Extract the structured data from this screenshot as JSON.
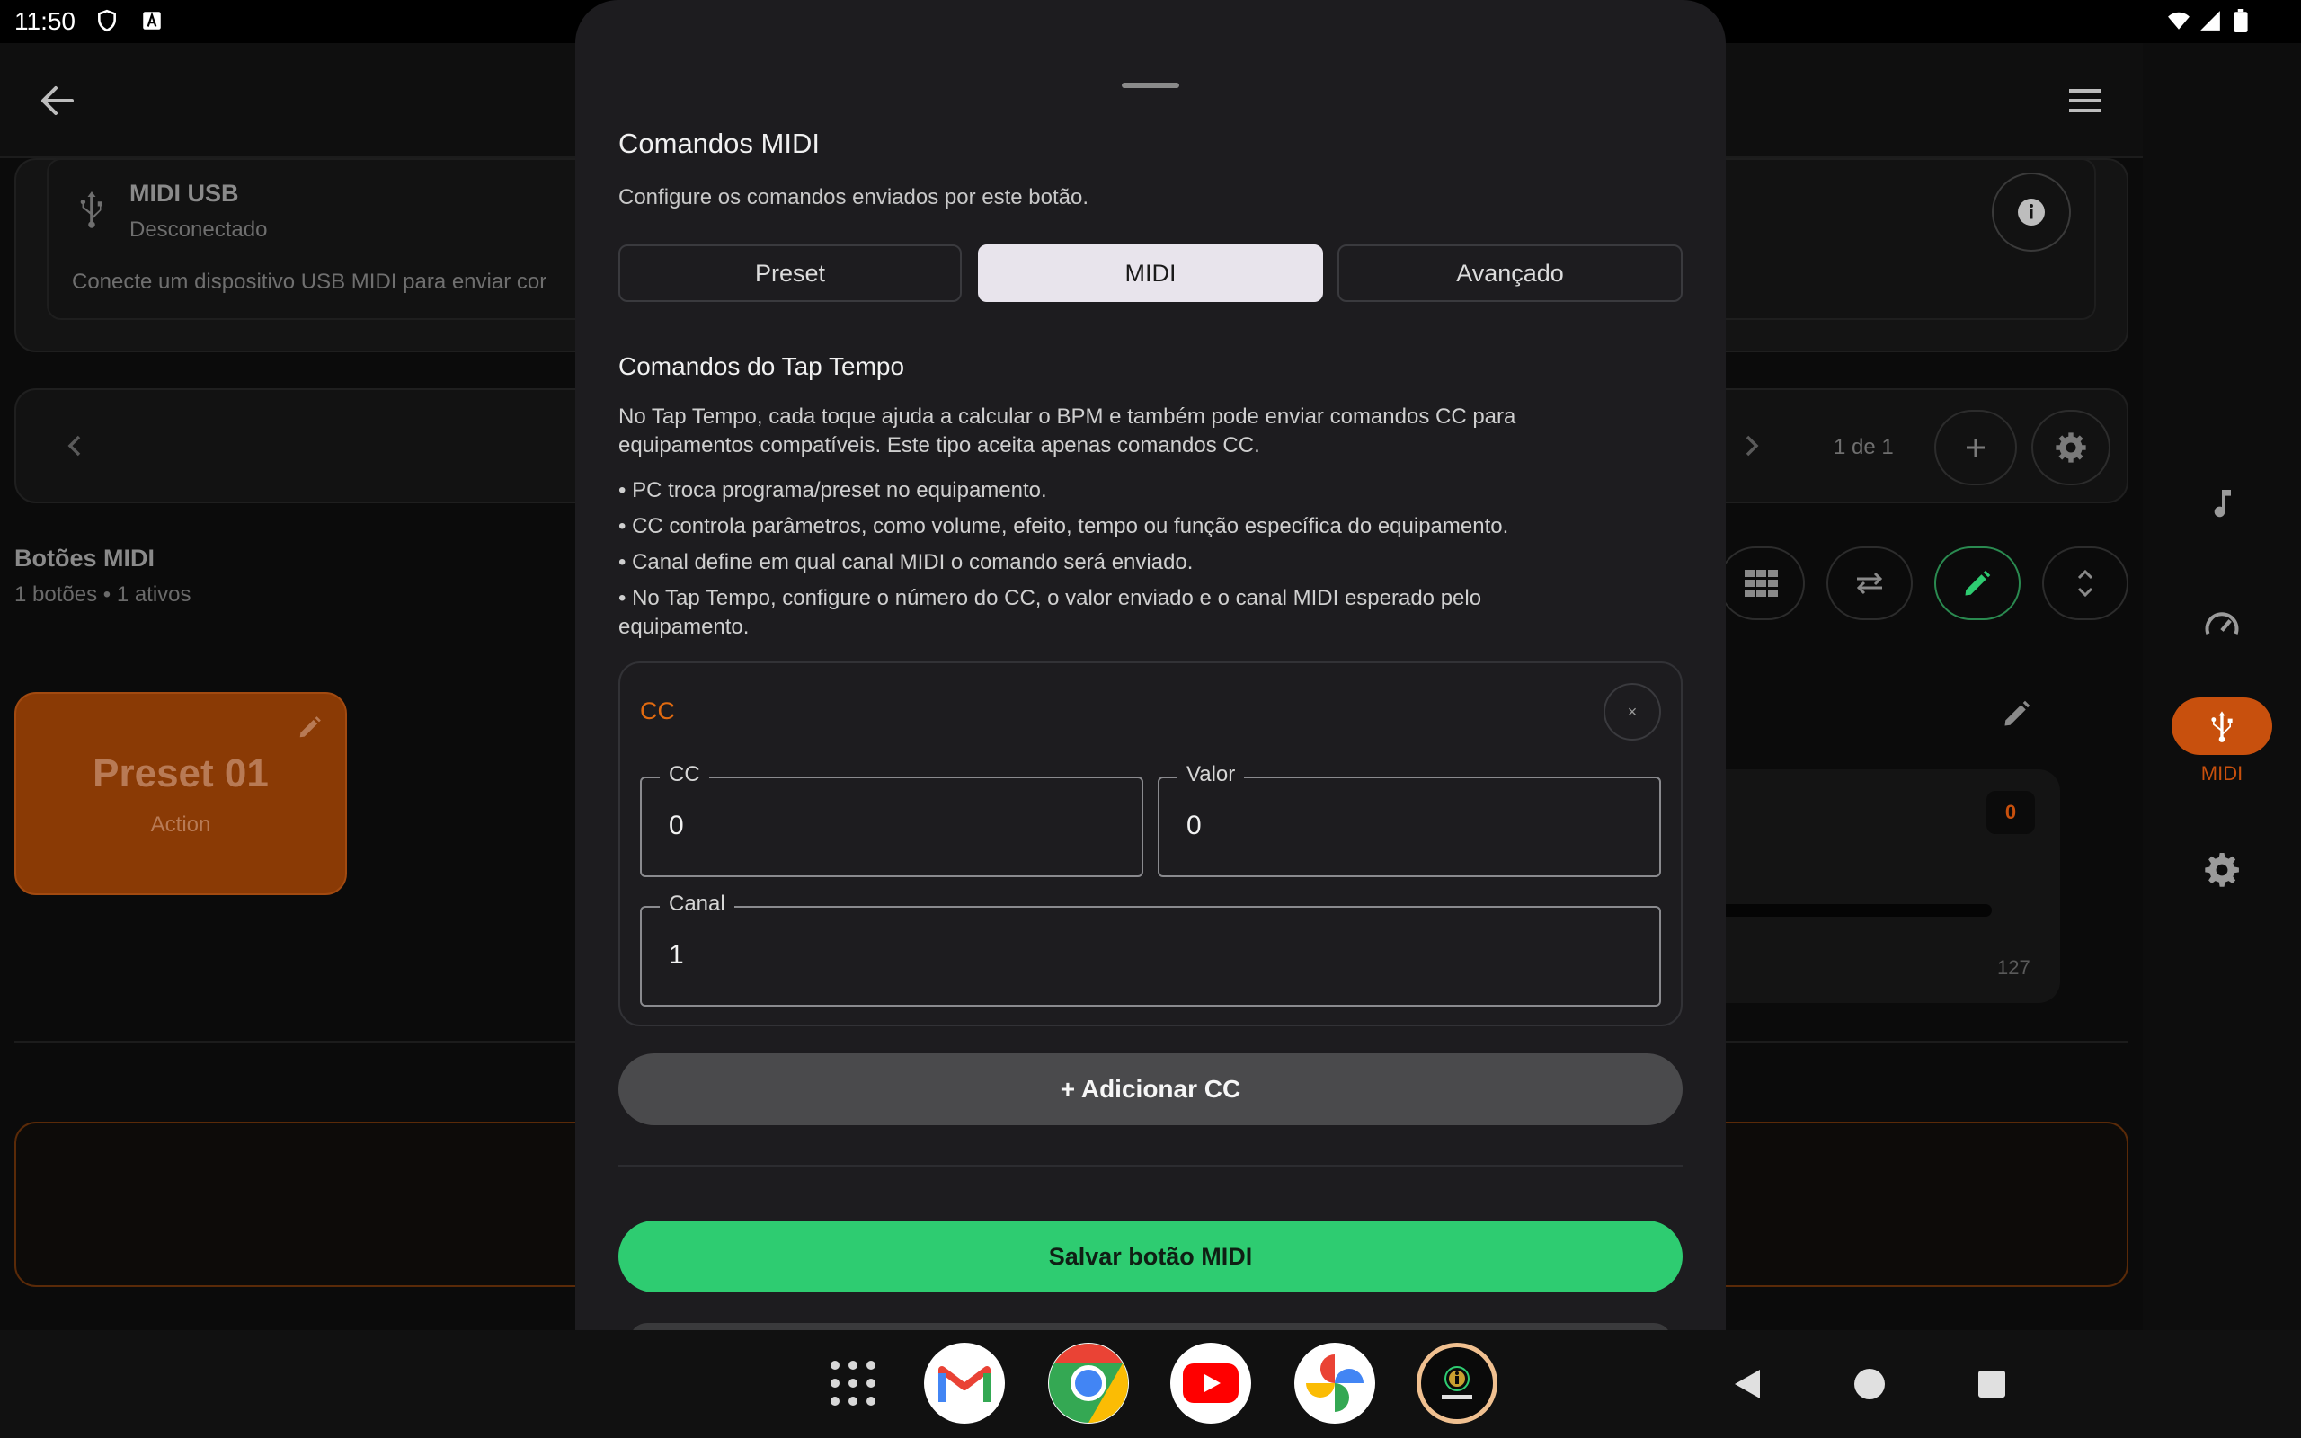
{
  "status_bar": {
    "time": "11:50"
  },
  "app": {
    "midi_usb": {
      "title": "MIDI USB",
      "status": "Desconectado",
      "description": "Conecte um dispositivo USB MIDI para enviar cor"
    },
    "pager": {
      "count": "1 de 1"
    },
    "section": {
      "title": "Botões MIDI",
      "subtitle": "1 botões • 1 ativos"
    },
    "preset_card": {
      "name": "Preset 01",
      "action": "Action"
    },
    "cc_panel": {
      "badge": "0",
      "max": "127"
    },
    "rail": {
      "active_label": "MIDI"
    }
  },
  "sheet": {
    "title": "Comandos MIDI",
    "subtitle": "Configure os comandos enviados por este botão.",
    "tabs": [
      {
        "label": "Preset"
      },
      {
        "label": "MIDI"
      },
      {
        "label": "Avançado"
      }
    ],
    "active_tab": "MIDI",
    "tap_section": {
      "title": "Comandos do Tap Tempo",
      "intro": "No Tap Tempo, cada toque ajuda a calcular o BPM e também pode enviar comandos CC para equipamentos compatíveis. Este tipo aceita apenas comandos CC.",
      "bullets": [
        "• PC troca programa/preset no equipamento.",
        "• CC controla parâmetros, como volume, efeito, tempo ou função específica do equipamento.",
        "• Canal define em qual canal MIDI o comando será enviado.",
        "• No Tap Tempo, configure o número do CC, o valor enviado e o canal MIDI esperado pelo equipamento."
      ]
    },
    "cc_entry": {
      "label": "CC",
      "close_glyph": "×",
      "fields": {
        "cc": {
          "label": "CC",
          "value": "0"
        },
        "valor": {
          "label": "Valor",
          "value": "0"
        },
        "canal": {
          "label": "Canal",
          "value": "1"
        }
      }
    },
    "add_button": "+ Adicionar CC",
    "save_button": "Salvar botão MIDI"
  },
  "colors": {
    "accent_orange": "#c8500d",
    "save_green": "#2ecc71",
    "sheet_bg": "#1d1c1f"
  }
}
